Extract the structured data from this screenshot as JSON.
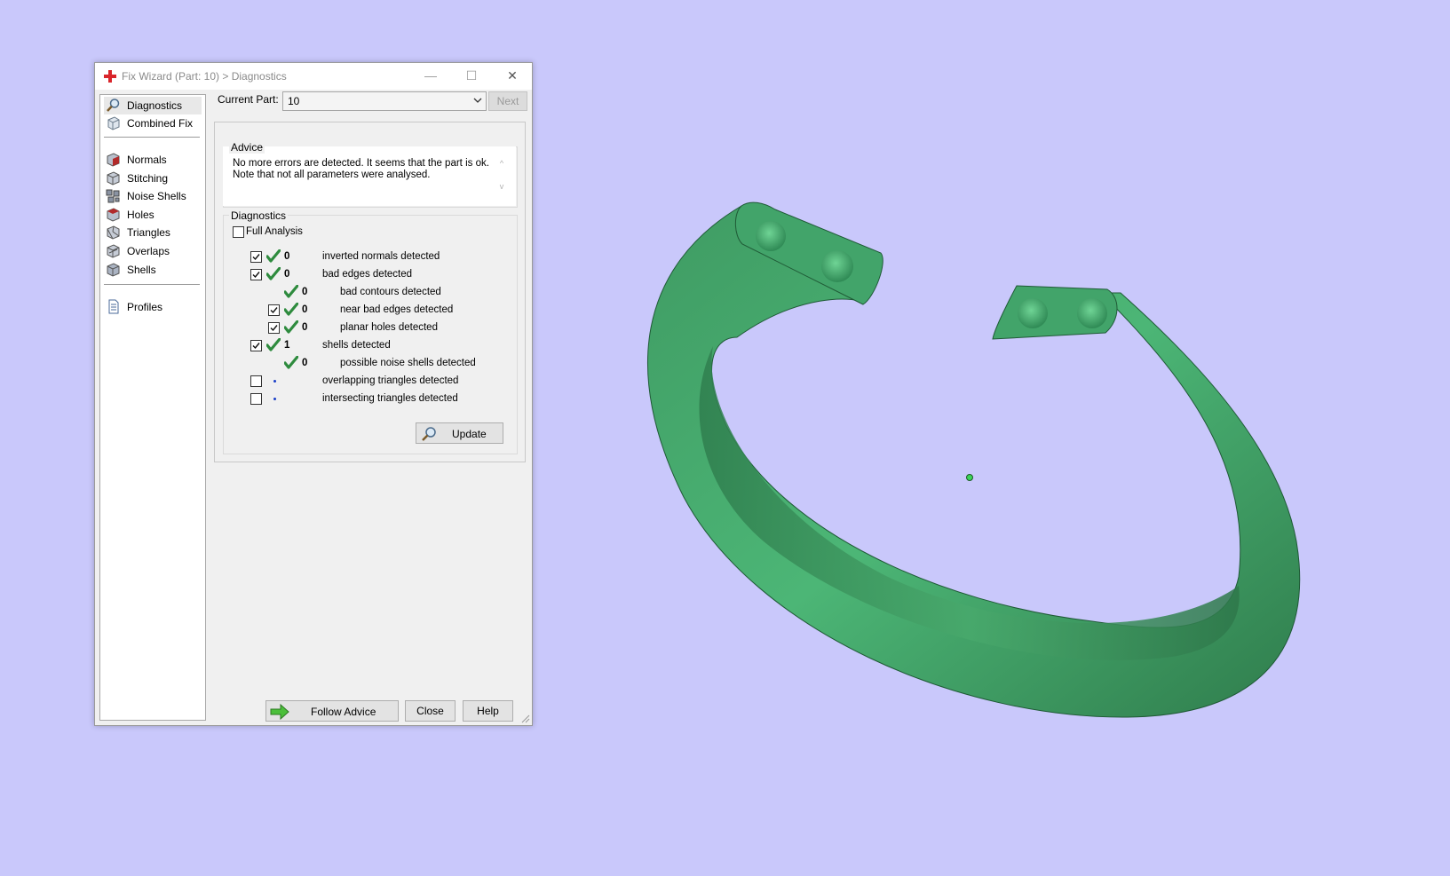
{
  "window": {
    "title": "Fix Wizard (Part: 10) > Diagnostics",
    "minimize_glyph": "—",
    "maximize_glyph": "☐",
    "close_glyph": "✕"
  },
  "sidebar": {
    "items": [
      {
        "label": "Diagnostics",
        "icon": "magnifier-icon",
        "selected": true
      },
      {
        "label": "Combined Fix",
        "icon": "cube-icon"
      },
      {
        "label": "Normals",
        "icon": "normals-cube-icon"
      },
      {
        "label": "Stitching",
        "icon": "stitching-cube-icon"
      },
      {
        "label": "Noise Shells",
        "icon": "noise-shells-icon"
      },
      {
        "label": "Holes",
        "icon": "holes-cube-icon"
      },
      {
        "label": "Triangles",
        "icon": "triangles-cube-icon"
      },
      {
        "label": "Overlaps",
        "icon": "overlaps-cube-icon"
      },
      {
        "label": "Shells",
        "icon": "shells-cube-icon"
      },
      {
        "label": "Profiles",
        "icon": "document-icon"
      }
    ]
  },
  "current_part": {
    "label": "Current Part:",
    "value": "10",
    "next_label": "Next"
  },
  "advice": {
    "title": "Advice",
    "line1": "No more errors are detected. It seems that the part is ok.",
    "line2": "Note that not all parameters were analysed.",
    "scroll_up": "^",
    "scroll_down": "v"
  },
  "diagnostics": {
    "title": "Diagnostics",
    "full_analysis_label": "Full Analysis",
    "full_analysis_checked": false,
    "rows": [
      {
        "label": "inverted normals detected",
        "count": "0",
        "checked": true,
        "status": "ok",
        "indent": 0
      },
      {
        "label": "bad edges detected",
        "count": "0",
        "checked": true,
        "status": "ok",
        "indent": 0
      },
      {
        "label": "bad contours detected",
        "count": "0",
        "checked": null,
        "status": "ok",
        "indent": 1
      },
      {
        "label": "near bad edges detected",
        "count": "0",
        "checked": true,
        "status": "ok",
        "indent": 1
      },
      {
        "label": "planar holes detected",
        "count": "0",
        "checked": true,
        "status": "ok",
        "indent": 1
      },
      {
        "label": "shells detected",
        "count": "1",
        "checked": true,
        "status": "ok",
        "indent": 0
      },
      {
        "label": "possible noise shells detected",
        "count": "0",
        "checked": null,
        "status": "ok",
        "indent": 1
      },
      {
        "label": "overlapping triangles detected",
        "count": "",
        "checked": false,
        "status": "pending",
        "indent": 0
      },
      {
        "label": "intersecting triangles detected",
        "count": "",
        "checked": false,
        "status": "pending",
        "indent": 0
      }
    ],
    "update_label": "Update"
  },
  "footer": {
    "follow_advice_label": "Follow Advice",
    "close_label": "Close",
    "help_label": "Help"
  },
  "colors": {
    "viewport_bg": "#c9c8fb",
    "model_green": "#4caf72",
    "tick_green": "#2e8b3e",
    "pending_dot": "#1a3fc9"
  }
}
